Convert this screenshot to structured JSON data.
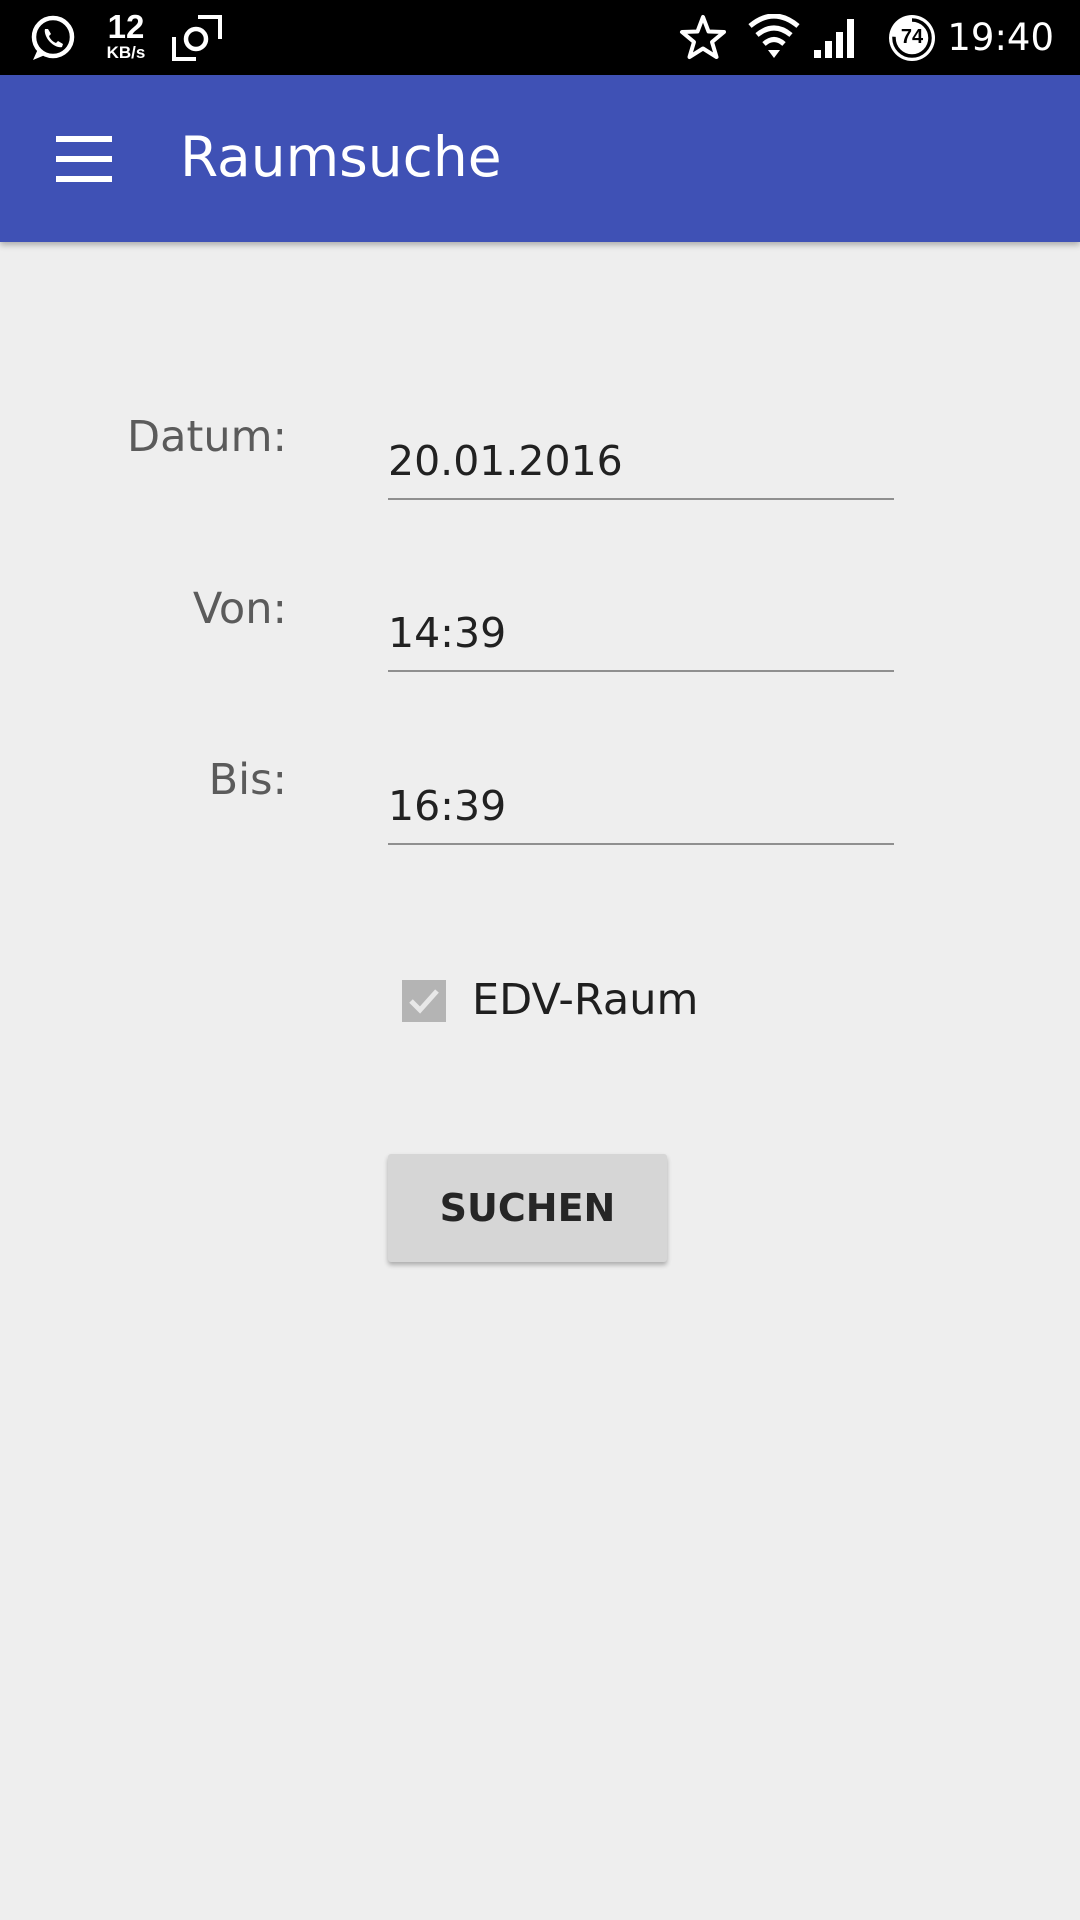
{
  "status_bar": {
    "icons": [
      "whatsapp-icon",
      "screen-rotation-icon",
      "star-icon",
      "wifi-icon",
      "cell-signal-icon",
      "battery-icon"
    ],
    "network_speed_value": "12",
    "network_speed_unit": "KB/s",
    "battery_level": "74",
    "clock": "19:40"
  },
  "app_bar": {
    "menu_icon": "hamburger-menu-icon",
    "title": "Raumsuche",
    "color": "#3f51b5"
  },
  "form": {
    "date": {
      "label": "Datum:",
      "value": "20.01.2016"
    },
    "from": {
      "label": "Von:",
      "value": "14:39"
    },
    "to": {
      "label": "Bis:",
      "value": "16:39"
    },
    "edv_room": {
      "label": "EDV-Raum",
      "checked": true,
      "enabled": false
    },
    "search_button_label": "SUCHEN"
  }
}
